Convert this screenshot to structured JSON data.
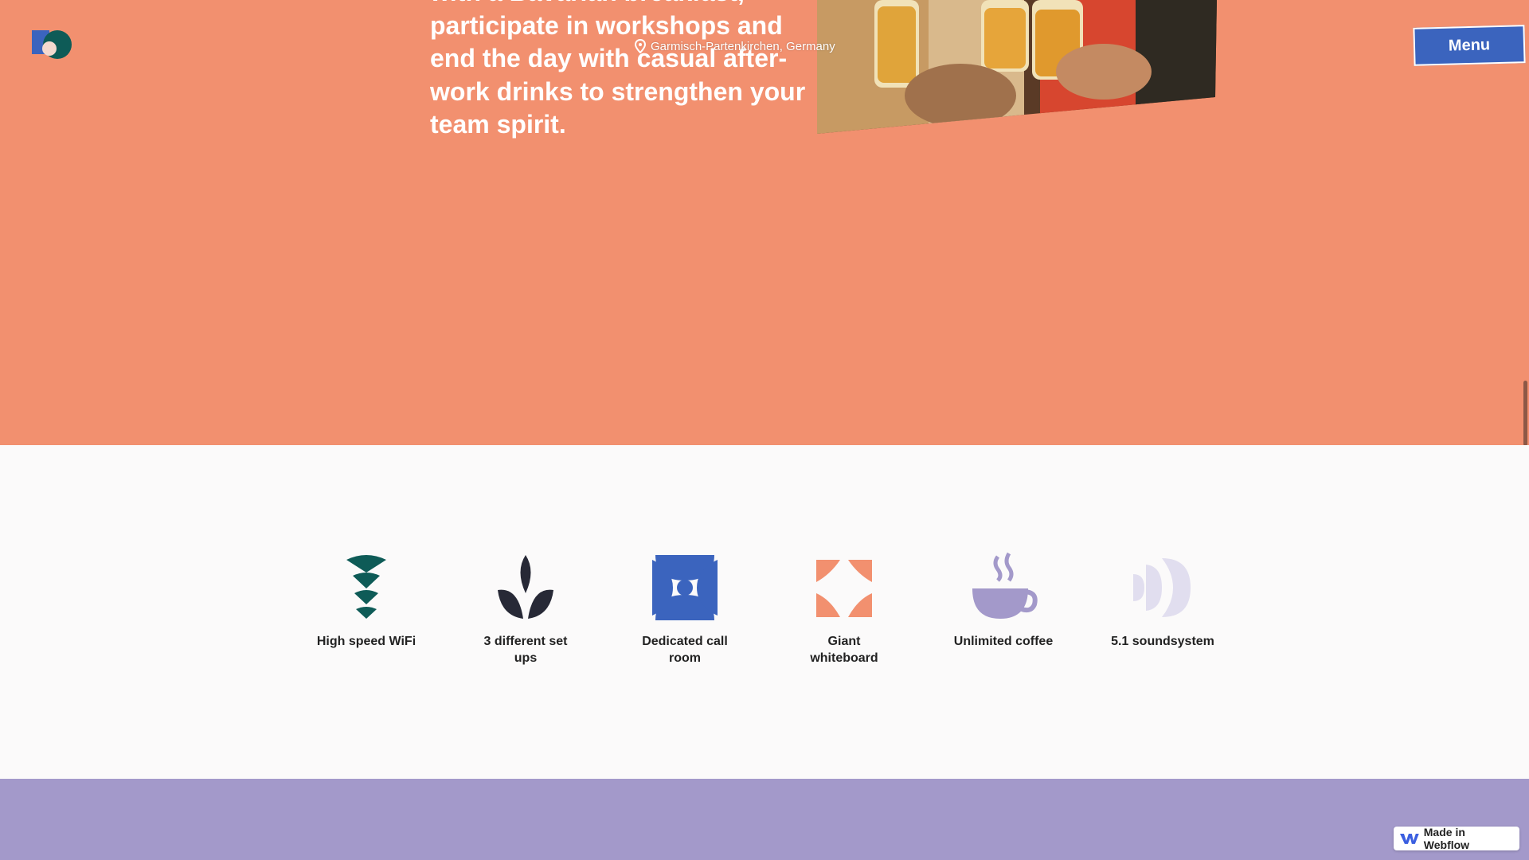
{
  "hero": {
    "text": "with a Bavarian breakfast, participate in workshops and end the day with casual after-work drinks to strengthen your team spirit.",
    "location": "Garmisch-Partenkirchen, Germany",
    "background": "#f2906f"
  },
  "header": {
    "logo_icon": "brand-logo",
    "menu_label": "Menu",
    "menu_color": "#3b64be"
  },
  "amenities": [
    {
      "label": "High speed WiFi",
      "icon": "wifi-icon",
      "color": "#0e5b57"
    },
    {
      "label": "3 different set ups",
      "icon": "leaves-icon",
      "color": "#272936"
    },
    {
      "label": "Dedicated call room",
      "icon": "call-room-icon",
      "color": "#3b64be"
    },
    {
      "label": "Giant whiteboard",
      "icon": "whiteboard-icon",
      "color": "#f2906f"
    },
    {
      "label": "Unlimited coffee",
      "icon": "coffee-icon",
      "color": "#a399ca"
    },
    {
      "label": "5.1 soundsystem",
      "icon": "sound-icon",
      "color": "#e1deef"
    }
  ],
  "footer": {
    "background": "#a399ca",
    "badge_label": "Made in Webflow"
  }
}
